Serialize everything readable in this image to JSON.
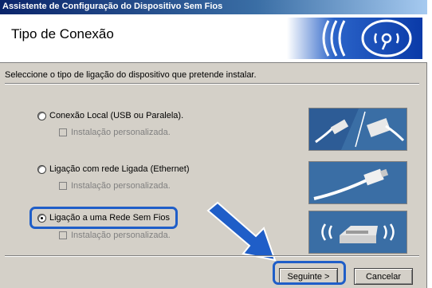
{
  "window": {
    "title": "Assistente de Configuração do Dispositivo Sem Fios"
  },
  "header": {
    "title": "Tipo de Conexão"
  },
  "prompt": "Seleccione o tipo de ligação do dispositivo que pretende instalar.",
  "options": [
    {
      "label": "Conexão Local (USB ou Paralela).",
      "checkbox": "Instalação personalizada.",
      "selected": false,
      "image": "usb-parallel-cables"
    },
    {
      "label": "Ligação com rede Ligada (Ethernet)",
      "checkbox": "Instalação personalizada.",
      "selected": false,
      "image": "ethernet-cable"
    },
    {
      "label": "Ligação a uma Rede Sem Fios",
      "checkbox": "Instalação personalizada.",
      "selected": true,
      "image": "wireless-printer"
    }
  ],
  "buttons": {
    "next": "Seguinte >",
    "cancel": "Cancelar"
  },
  "colors": {
    "highlight": "#1f5ec8",
    "title_bar": "#0a246a",
    "image_bg": "#3a6ea5"
  }
}
